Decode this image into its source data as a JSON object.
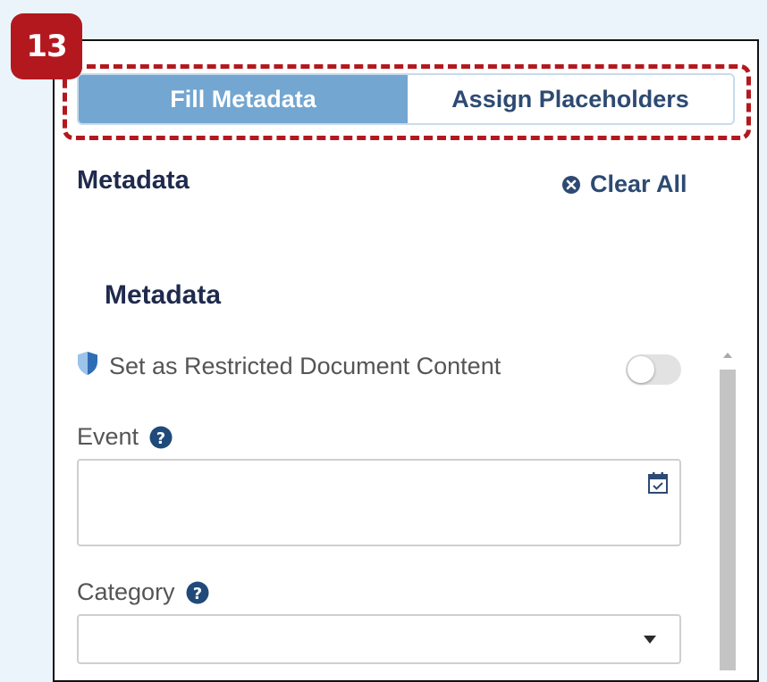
{
  "annotation": {
    "step_number": "13",
    "badge_color": "#b3181e"
  },
  "tabs": [
    {
      "label": "Fill Metadata",
      "active": true
    },
    {
      "label": "Assign Placeholders",
      "active": false
    }
  ],
  "panel": {
    "title": "Metadata",
    "clear_all_label": "Clear All",
    "clear_all_icon": "times-circle-icon"
  },
  "section": {
    "title": "Metadata"
  },
  "restricted": {
    "label": "Set as Restricted Document Content",
    "icon": "shield-icon",
    "enabled": false
  },
  "fields": [
    {
      "label": "Event",
      "value": "",
      "icon": "calendar-check-icon",
      "help_icon": "question-circle-icon"
    },
    {
      "label": "Category",
      "value": "",
      "icon": "caret-down-icon",
      "help_icon": "question-circle-icon"
    }
  ],
  "colors": {
    "accent": "#73a6d0",
    "heading": "#1f2a4d",
    "link": "#2d4a72",
    "icon_blue": "#1f4a7a"
  }
}
